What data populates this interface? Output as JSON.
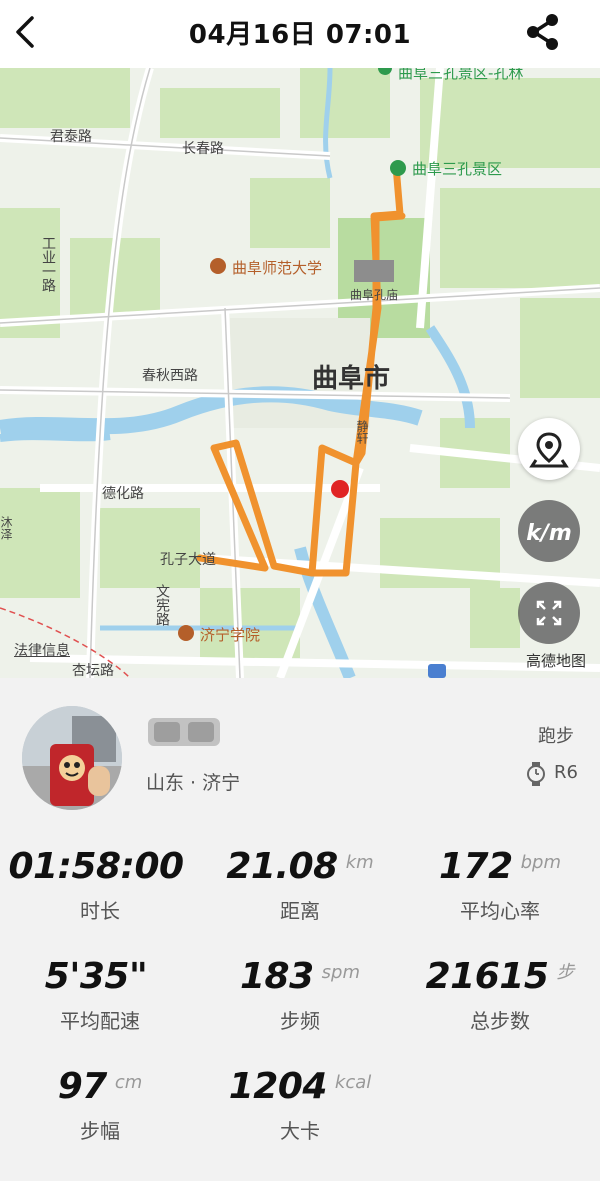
{
  "header": {
    "title": "04月16日 07:01",
    "back_icon": "chevron-left-icon",
    "share_icon": "share-icon"
  },
  "map": {
    "labels": {
      "top_cut": "曲阜三孔景区-孔林",
      "jun_tai_road": "君泰路",
      "chang_chun_road": "长春路",
      "san_kong": "曲阜三孔景区",
      "industry_road": "工业一路",
      "normal_university": "曲阜师范大学",
      "kong_miao": "曲阜孔庙",
      "chun_qiu_road": "春秋西路",
      "city": "曲阜市",
      "jing_road": "静轩",
      "de_hua_road": "德化路",
      "kong_zi_avenue": "孔子大道",
      "wen_xian_road": "文宪路",
      "jining_university": "济宁学院",
      "mu_road": "沐泽",
      "legal_info": "法律信息",
      "xing_tan_road": "杏坛路"
    },
    "attribution": "高德地图",
    "route_color": "#f0922e",
    "marker_color": "#e02424",
    "buttons": [
      "location-pin-icon",
      "km-toggle-icon",
      "fullscreen-icon"
    ]
  },
  "profile": {
    "name": "森蝶",
    "location": "山东 · 济宁",
    "activity_type": "跑步",
    "device": "R6"
  },
  "stats": [
    {
      "value": "01:58:00",
      "unit": "",
      "label": "时长"
    },
    {
      "value": "21.08",
      "unit": "km",
      "label": "距离"
    },
    {
      "value": "172",
      "unit": "bpm",
      "label": "平均心率"
    },
    {
      "value": "5'35\"",
      "unit": "",
      "label": "平均配速"
    },
    {
      "value": "183",
      "unit": "spm",
      "label": "步频"
    },
    {
      "value": "21615",
      "unit": "步",
      "label": "总步数"
    },
    {
      "value": "97",
      "unit": "cm",
      "label": "步幅"
    },
    {
      "value": "1204",
      "unit": "kcal",
      "label": "大卡"
    }
  ]
}
